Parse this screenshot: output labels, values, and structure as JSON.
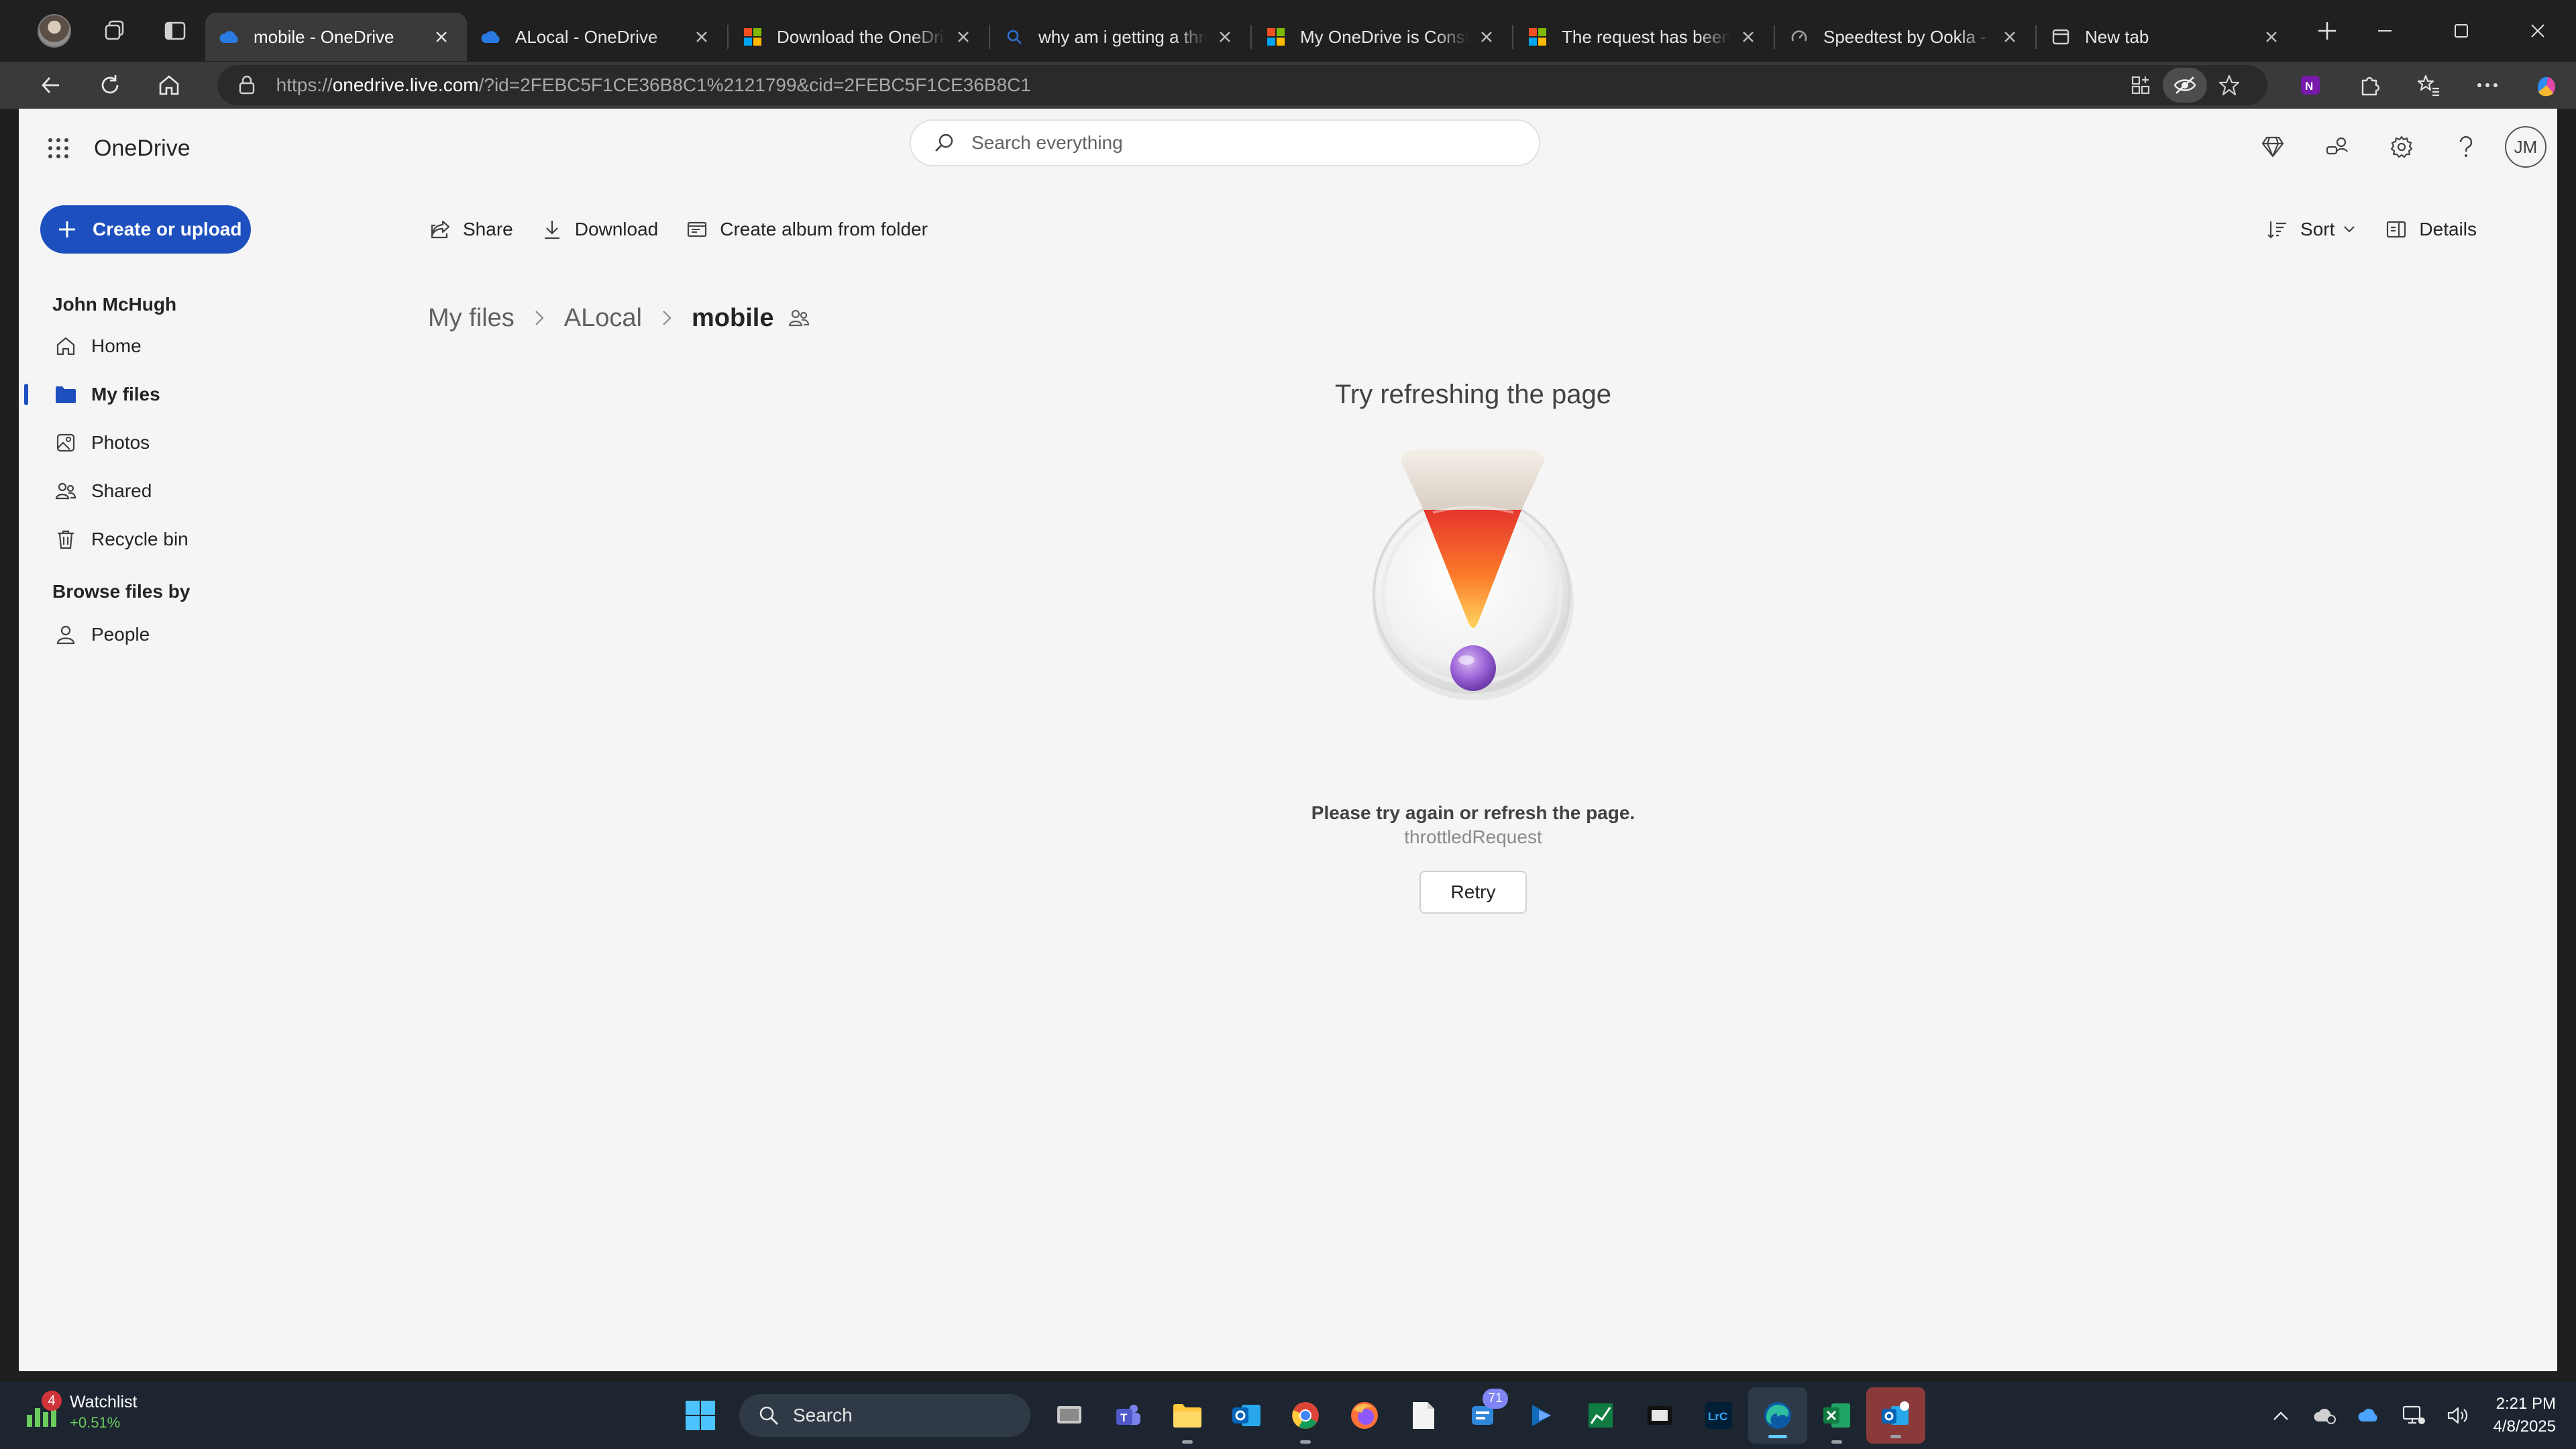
{
  "browser": {
    "tabs": [
      {
        "title": "mobile - OneDrive",
        "icon": "onedrive-cloud-icon",
        "active": true
      },
      {
        "title": "ALocal - OneDrive",
        "icon": "onedrive-cloud-icon",
        "active": false
      },
      {
        "title": "Download the OneDrive a",
        "icon": "microsoft-logo-icon",
        "active": false
      },
      {
        "title": "why am i getting a thrott",
        "icon": "search-icon",
        "active": false
      },
      {
        "title": "My OneDrive is Constant",
        "icon": "microsoft-logo-icon",
        "active": false
      },
      {
        "title": "The request has been thr",
        "icon": "windows-logo-icon",
        "active": false
      },
      {
        "title": "Speedtest by Ookla - The",
        "icon": "speedtest-icon",
        "active": false
      },
      {
        "title": "New tab",
        "icon": "new-tab-icon",
        "active": false
      }
    ],
    "url_prefix": "https://",
    "url_host": "onedrive.live.com",
    "url_rest": "/?id=2FEBC5F1CE36B8C1%2121799&cid=2FEBC5F1CE36B8C1"
  },
  "onedrive": {
    "brand": "OneDrive",
    "search_placeholder": "Search everything",
    "user_initials": "JM",
    "create_label": "Create or upload",
    "commands": {
      "share": "Share",
      "download": "Download",
      "create_album": "Create album from folder",
      "sort": "Sort",
      "details": "Details"
    },
    "nav": {
      "owner": "John McHugh",
      "items": [
        {
          "label": "Home",
          "icon": "home-icon"
        },
        {
          "label": "My files",
          "icon": "folder-icon",
          "selected": true
        },
        {
          "label": "Photos",
          "icon": "photos-icon"
        },
        {
          "label": "Shared",
          "icon": "shared-people-icon"
        },
        {
          "label": "Recycle bin",
          "icon": "recycle-bin-icon"
        }
      ],
      "browse_title": "Browse files by",
      "browse_items": [
        {
          "label": "People",
          "icon": "person-icon"
        }
      ]
    },
    "breadcrumb": [
      "My files",
      "ALocal",
      "mobile"
    ],
    "error": {
      "title": "Try refreshing the page",
      "message": "Please try again or refresh the page.",
      "code": "throttledRequest",
      "retry_label": "Retry"
    }
  },
  "taskbar": {
    "watchlist_title": "Watchlist",
    "watchlist_change": "+0.51%",
    "watchlist_badge": "4",
    "search_label": "Search",
    "teams_badge": "71",
    "time": "2:21 PM",
    "date": "4/8/2025"
  }
}
